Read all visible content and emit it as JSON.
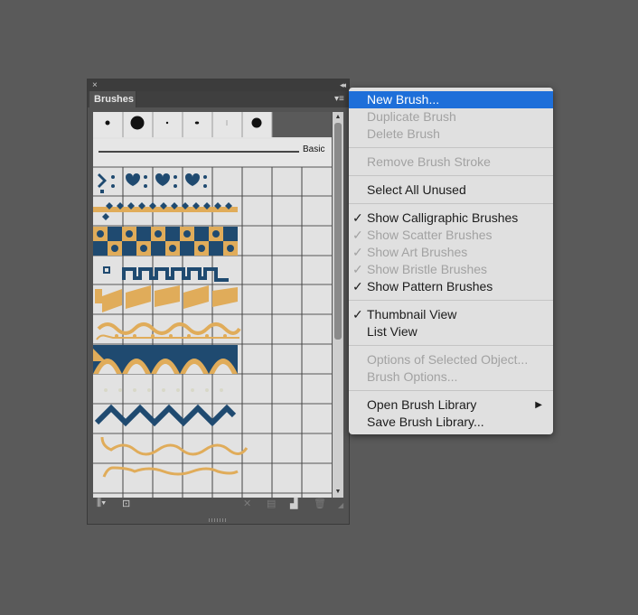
{
  "panel": {
    "tab_label": "Brushes",
    "basic_label": "Basic",
    "close_glyph": "×",
    "collapse_glyph": "◂◂",
    "menu_glyph": "▾≡"
  },
  "menu": {
    "items": [
      {
        "label": "New Brush...",
        "state": "highlighted"
      },
      {
        "label": "Duplicate Brush",
        "state": "disabled"
      },
      {
        "label": "Delete Brush",
        "state": "disabled"
      },
      {
        "label": "Remove Brush Stroke",
        "state": "disabled"
      },
      {
        "label": "Select All Unused",
        "state": "enabled"
      },
      {
        "label": "Show Calligraphic Brushes",
        "state": "enabled",
        "checked": true
      },
      {
        "label": "Show Scatter Brushes",
        "state": "disabled",
        "checked": true
      },
      {
        "label": "Show Art Brushes",
        "state": "disabled",
        "checked": true
      },
      {
        "label": "Show Bristle Brushes",
        "state": "disabled",
        "checked": true
      },
      {
        "label": "Show Pattern Brushes",
        "state": "enabled",
        "checked": true
      },
      {
        "label": "Thumbnail View",
        "state": "enabled",
        "checked": true
      },
      {
        "label": "List View",
        "state": "enabled"
      },
      {
        "label": "Options of Selected Object...",
        "state": "disabled"
      },
      {
        "label": "Brush Options...",
        "state": "disabled"
      },
      {
        "label": "Open Brush Library",
        "state": "enabled",
        "submenu": true
      },
      {
        "label": "Save Brush Library...",
        "state": "enabled"
      }
    ],
    "check_glyph": "✓",
    "submenu_glyph": "▶"
  },
  "colors": {
    "navy": "#1f4a70",
    "gold": "#e0ac5a",
    "highlight": "#1e6fd9"
  }
}
